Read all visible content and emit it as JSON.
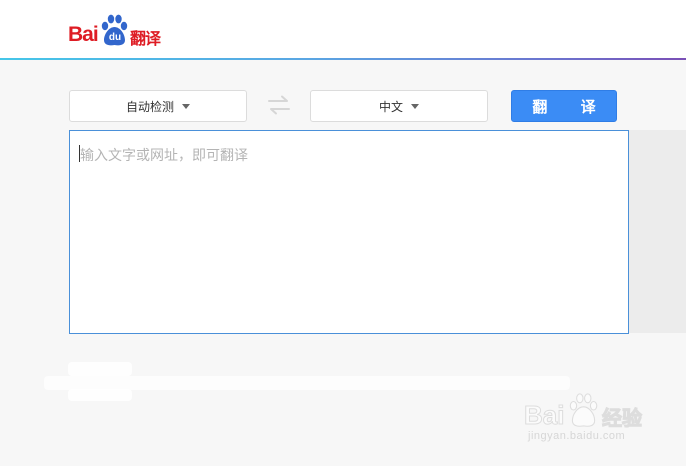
{
  "header": {
    "logo": {
      "brand_text": "Bai",
      "brand_du": "du",
      "product_text": "翻译",
      "icon": "baidu-paw-icon",
      "color": "#de1c24"
    }
  },
  "toolbar": {
    "source_language": "自动检测",
    "target_language": "中文",
    "swap_icon": "swap-arrows-icon",
    "translate_label": "翻 译",
    "accent_color": "#3b8cf5"
  },
  "input": {
    "placeholder": "输入文字或网址，即可翻译",
    "value": ""
  },
  "watermark": {
    "brand_text": "Bai",
    "suffix_text": "经验",
    "url": "jingyan.baidu.com"
  }
}
